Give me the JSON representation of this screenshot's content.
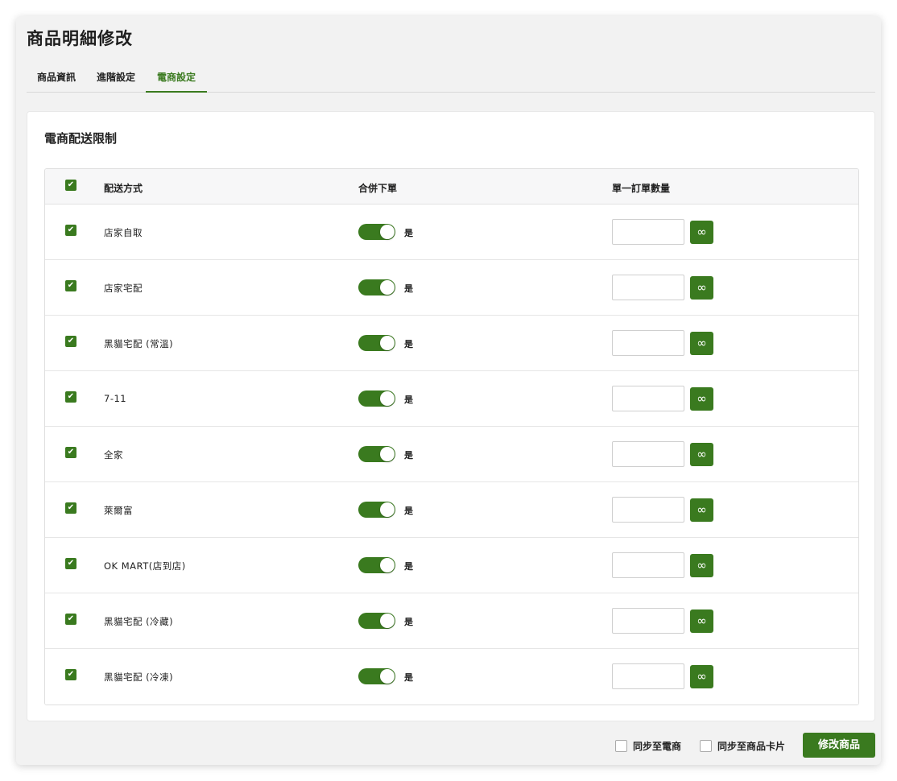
{
  "modal": {
    "title": "商品明細修改"
  },
  "tabs": [
    {
      "label": "商品資訊"
    },
    {
      "label": "進階設定"
    },
    {
      "label": "電商設定"
    }
  ],
  "section": {
    "title": "電商配送限制"
  },
  "table": {
    "headers": {
      "method": "配送方式",
      "merge": "合併下單",
      "qty": "單一訂單數量"
    },
    "rows": [
      {
        "method": "店家自取",
        "checked": true,
        "merge_on": true,
        "merge_label": "是",
        "qty": ""
      },
      {
        "method": "店家宅配",
        "checked": true,
        "merge_on": true,
        "merge_label": "是",
        "qty": ""
      },
      {
        "method": "黑貓宅配 (常溫)",
        "checked": true,
        "merge_on": true,
        "merge_label": "是",
        "qty": ""
      },
      {
        "method": "7-11",
        "checked": true,
        "merge_on": true,
        "merge_label": "是",
        "qty": ""
      },
      {
        "method": "全家",
        "checked": true,
        "merge_on": true,
        "merge_label": "是",
        "qty": ""
      },
      {
        "method": "萊爾富",
        "checked": true,
        "merge_on": true,
        "merge_label": "是",
        "qty": ""
      },
      {
        "method": "OK MART(店到店)",
        "checked": true,
        "merge_on": true,
        "merge_label": "是",
        "qty": ""
      },
      {
        "method": "黑貓宅配 (冷藏)",
        "checked": true,
        "merge_on": true,
        "merge_label": "是",
        "qty": ""
      },
      {
        "method": "黑貓宅配 (冷凍)",
        "checked": true,
        "merge_on": true,
        "merge_label": "是",
        "qty": ""
      }
    ]
  },
  "icons": {
    "check": "✔",
    "infinity": "∞"
  },
  "footer": {
    "sync_ecommerce": "同步至電商",
    "sync_card": "同步至商品卡片",
    "submit": "修改商品"
  },
  "colors": {
    "accent": "#3a7a1f"
  }
}
